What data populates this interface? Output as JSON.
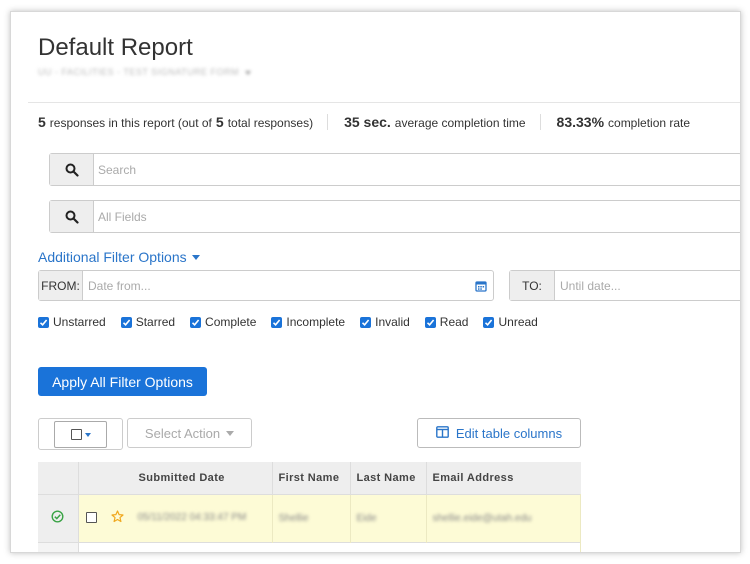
{
  "report": {
    "title": "Default Report",
    "subtitle": "UU - FACILITIES - TEST SIGNATURE FORM"
  },
  "stats": {
    "responses_count": "5",
    "responses_text_a": "responses in this report (out of",
    "total_count": "5",
    "responses_text_b": "total responses)",
    "avg_time": "35 sec.",
    "avg_time_label": "average completion time",
    "completion_rate": "83.33%",
    "completion_rate_label": "completion rate"
  },
  "search": {
    "placeholder": "Search"
  },
  "fields_search": {
    "placeholder": "All Fields"
  },
  "filters": {
    "link_label": "Additional Filter Options",
    "from_label": "FROM:",
    "from_placeholder": "Date from...",
    "to_label": "TO:",
    "to_placeholder": "Until date...",
    "checkboxes": [
      {
        "label": "Unstarred",
        "checked": true
      },
      {
        "label": "Starred",
        "checked": true
      },
      {
        "label": "Complete",
        "checked": true
      },
      {
        "label": "Incomplete",
        "checked": true
      },
      {
        "label": "Invalid",
        "checked": true
      },
      {
        "label": "Read",
        "checked": true
      },
      {
        "label": "Unread",
        "checked": true
      }
    ],
    "apply_label": "Apply All Filter Options"
  },
  "toolbar": {
    "select_action_label": "Select Action",
    "edit_columns_label": "Edit table columns"
  },
  "table": {
    "columns": [
      "Submitted Date",
      "First Name",
      "Last Name",
      "Email Address"
    ],
    "rows": [
      {
        "submitted": "05/11/2022 04:33:47 PM",
        "first": "Shellie",
        "last": "Eide",
        "email": "shellie.eide@utah.edu"
      }
    ]
  },
  "colors": {
    "accent": "#1a73d9",
    "link": "#2a75c9",
    "row_highlight": "#fdfbd6",
    "complete_icon": "#3aa346",
    "star": "#f0a81e"
  },
  "icons": [
    "search-icon",
    "calendar-icon",
    "caret-down-icon",
    "columns-icon",
    "check-circle-icon",
    "star-icon"
  ]
}
